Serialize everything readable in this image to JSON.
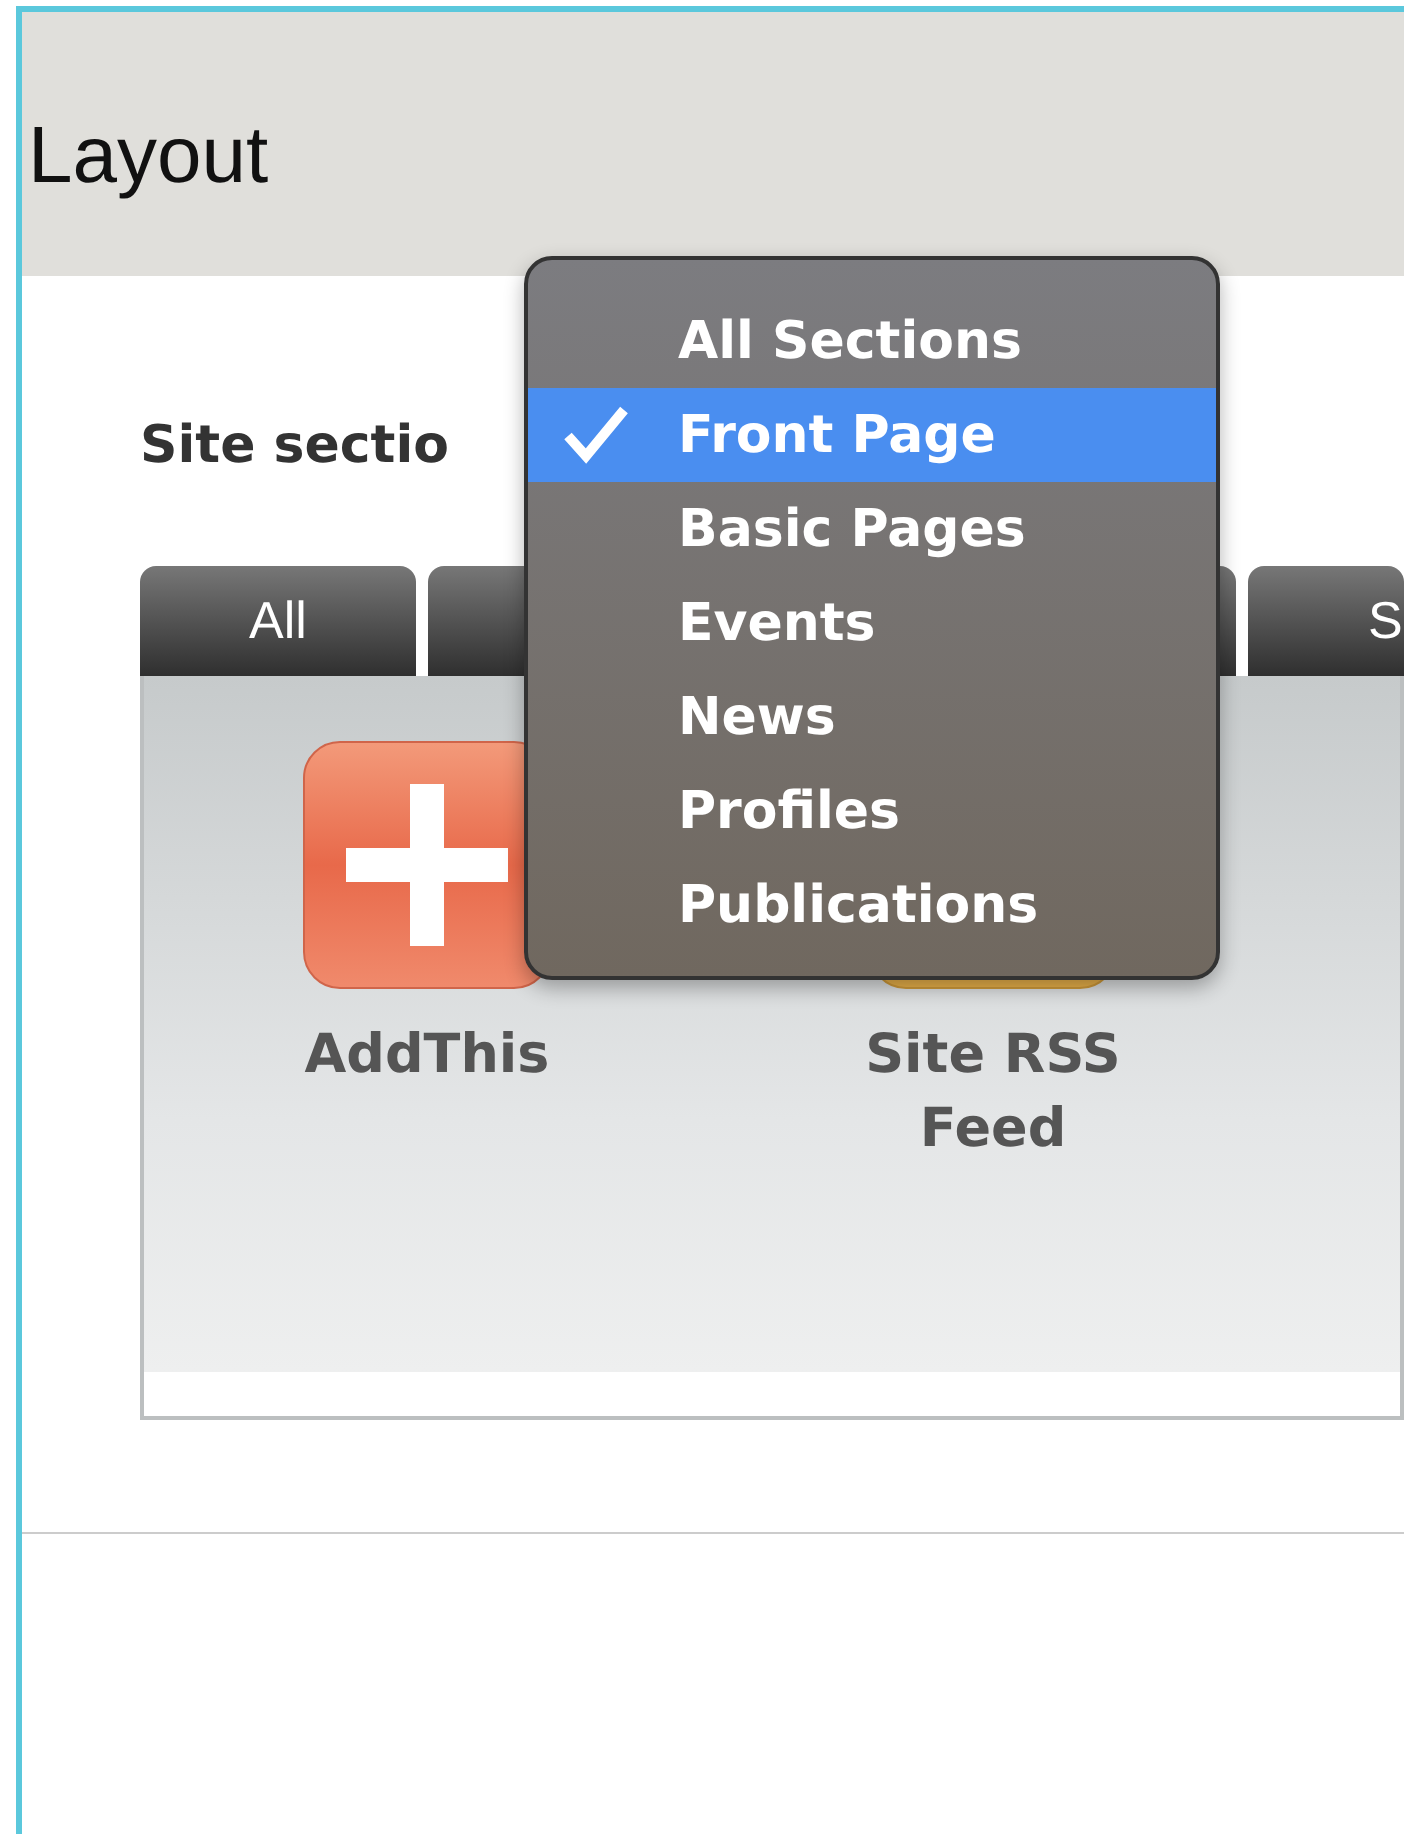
{
  "header": {
    "title": "Layout"
  },
  "site_section": {
    "label": "Site sectio"
  },
  "tabs": [
    {
      "label": "All"
    },
    {
      "label": "S"
    }
  ],
  "widgets": [
    {
      "kind": "add",
      "label": "AddThis"
    },
    {
      "kind": "rss",
      "label": "Site RSS Feed"
    }
  ],
  "dropdown": {
    "items": [
      {
        "label": "All Sections",
        "selected": false
      },
      {
        "label": "Front Page",
        "selected": true
      },
      {
        "label": "Basic Pages",
        "selected": false
      },
      {
        "label": "Events",
        "selected": false
      },
      {
        "label": "News",
        "selected": false
      },
      {
        "label": "Profiles",
        "selected": false
      },
      {
        "label": "Publications",
        "selected": false
      }
    ]
  }
}
